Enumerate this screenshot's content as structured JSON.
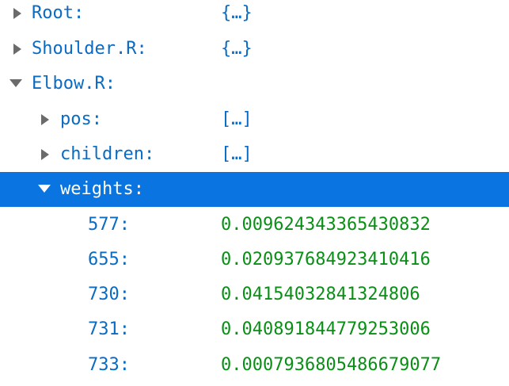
{
  "rows": [
    {
      "label": "Root:",
      "value": "{…}",
      "expanded": false,
      "depth": 0
    },
    {
      "label": "Shoulder.R:",
      "value": "{…}",
      "expanded": false,
      "depth": 0
    },
    {
      "label": "Elbow.R:",
      "value": "",
      "expanded": true,
      "depth": 0
    },
    {
      "label": "pos:",
      "value": "[…]",
      "expanded": false,
      "depth": 1
    },
    {
      "label": "children:",
      "value": "[…]",
      "expanded": false,
      "depth": 1
    },
    {
      "label": "weights:",
      "value": "",
      "expanded": true,
      "depth": 1,
      "selected": true
    },
    {
      "label": "577:",
      "value": "0.009624343365430832",
      "depth": 2
    },
    {
      "label": "655:",
      "value": "0.020937684923410416",
      "depth": 2
    },
    {
      "label": "730:",
      "value": "0.04154032841324806",
      "depth": 2
    },
    {
      "label": "731:",
      "value": "0.040891844779253006",
      "depth": 2
    },
    {
      "label": "733:",
      "value": "0.0007936805486679077",
      "depth": 2
    }
  ],
  "colors": {
    "key": "#0a6bc4",
    "number": "#0a8f16",
    "selection": "#0a74e0",
    "twisty": "#6b6b6b"
  }
}
